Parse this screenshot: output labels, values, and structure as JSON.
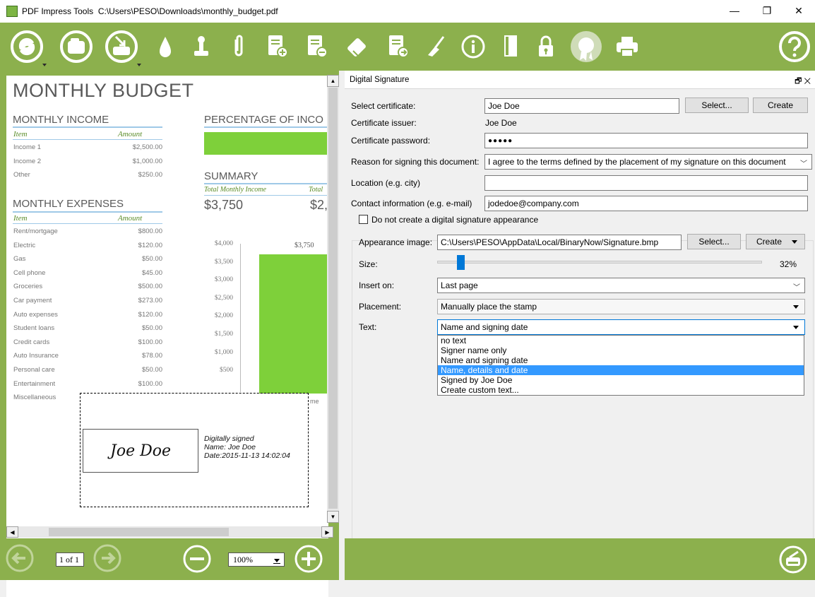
{
  "window": {
    "app_name": "PDF Impress Tools",
    "file_path": "C:\\Users\\PESO\\Downloads\\monthly_budget.pdf",
    "minimize": "—",
    "maximize": "❐",
    "close": "✕"
  },
  "colors": {
    "toolbar_green": "#8cb04d",
    "chart_green": "#7ed03a",
    "accent_blue": "#0078d7",
    "selection": "#3399ff"
  },
  "toolbar": {
    "icons": [
      "compress-icon",
      "open-document-icon",
      "import-icon",
      "watermark-drop-icon",
      "stamp-icon",
      "attachment-icon",
      "add-page-icon",
      "remove-page-icon",
      "eraser-icon",
      "extract-page-icon",
      "broom-clean-icon",
      "info-icon",
      "bookmark-icon",
      "lock-icon",
      "certificate-icon",
      "print-icon",
      "help-icon"
    ]
  },
  "document": {
    "title": "MONTHLY BUDGET",
    "income": {
      "heading": "MONTHLY INCOME",
      "col_item": "Item",
      "col_amount": "Amount",
      "rows": [
        {
          "item": "Income 1",
          "amount": "$2,500.00"
        },
        {
          "item": "Income 2",
          "amount": "$1,000.00"
        },
        {
          "item": "Other",
          "amount": "$250.00"
        }
      ]
    },
    "percentage_heading": "PERCENTAGE OF INCO",
    "summary": {
      "heading": "SUMMARY",
      "col1": "Total Monthly Income",
      "col2": "Total",
      "val1": "$3,750",
      "val2": "$2,:"
    },
    "expenses": {
      "heading": "MONTHLY EXPENSES",
      "col_item": "Item",
      "col_amount": "Amount",
      "rows": [
        {
          "item": "Rent/mortgage",
          "amount": "$800.00"
        },
        {
          "item": "Electric",
          "amount": "$120.00"
        },
        {
          "item": "Gas",
          "amount": "$50.00"
        },
        {
          "item": "Cell phone",
          "amount": "$45.00"
        },
        {
          "item": "Groceries",
          "amount": "$500.00"
        },
        {
          "item": "Car payment",
          "amount": "$273.00"
        },
        {
          "item": "Auto expenses",
          "amount": "$120.00"
        },
        {
          "item": "Student loans",
          "amount": "$50.00"
        },
        {
          "item": "Credit cards",
          "amount": "$100.00"
        },
        {
          "item": "Auto Insurance",
          "amount": "$78.00"
        },
        {
          "item": "Personal care",
          "amount": "$50.00"
        },
        {
          "item": "Entertainment",
          "amount": "$100.00"
        },
        {
          "item": "Miscellaneous",
          "amount": ""
        }
      ]
    },
    "chart_axis": [
      "$4,000",
      "$3,500",
      "$3,000",
      "$2,500",
      "$2,000",
      "$1,500",
      "$1,000",
      "$500"
    ],
    "chart_bar_label": "$3,750",
    "chart_bar_value": 3750,
    "chart_cut_label": "me",
    "signature": {
      "name_img": "Joe Doe",
      "line1": "Digitally signed",
      "line2": "Name: Joe Doe",
      "line3": "Date:2015-11-13 14:02:04"
    }
  },
  "nav": {
    "page_indicator": "1 of 1",
    "zoom": "100%"
  },
  "panel": {
    "title": "Digital Signature",
    "title_controls": "🗗 ✕",
    "select_certificate_label": "Select certificate:",
    "certificate_value": "Joe Doe",
    "select_btn": "Select...",
    "create_btn": "Create",
    "issuer_label": "Certificate issuer:",
    "issuer_value": "Joe Doe",
    "password_label": "Certificate password:",
    "password_value": "●●●●●",
    "reason_label": "Reason for signing this document:",
    "reason_value": "I agree to the terms defined by the placement of my signature on this document",
    "location_label": "Location (e.g. city)",
    "location_value": "",
    "contact_label": "Contact information (e.g. e-mail)",
    "contact_value": "jodedoe@company.com",
    "no_appearance_label": "Do not create a digital signature appearance",
    "appearance_label": "Appearance image:",
    "appearance_value": "C:\\Users\\PESO\\AppData\\Local/BinaryNow/Signature.bmp",
    "appearance_select_btn": "Select...",
    "appearance_create_btn": "Create",
    "size_label": "Size:",
    "size_value": "32%",
    "size_fraction": 0.32,
    "insert_label": "Insert on:",
    "insert_value": "Last page",
    "placement_label": "Placement:",
    "placement_value": "Manually place the stamp",
    "text_label": "Text:",
    "text_value": "Name and signing date",
    "text_options": [
      "no text",
      "Signer name only",
      "Name and signing date",
      "Name, details and date",
      "Signed by Joe Doe",
      "Create custom text..."
    ],
    "text_highlighted_index": 3
  }
}
